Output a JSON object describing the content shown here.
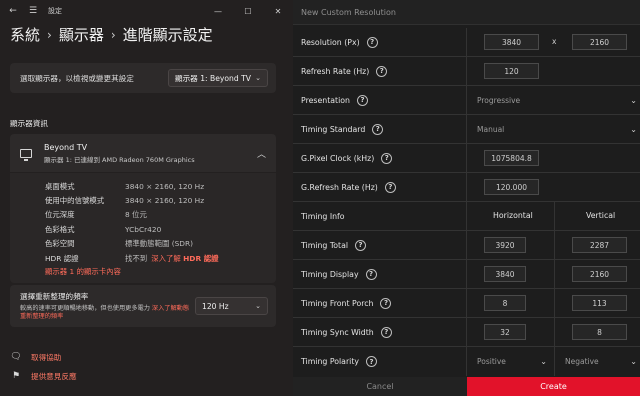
{
  "settings": {
    "window_title": "設定",
    "breadcrumb": [
      "系統",
      "顯示器",
      "進階顯示設定"
    ],
    "select_display": {
      "label": "選取顯示器，以檢視或變更其設定",
      "value": "顯示器 1: Beyond TV"
    },
    "section_title": "顯示器資訊",
    "display_info": {
      "name": "Beyond TV",
      "subtitle": "顯示器 1: 已連線到 AMD Radeon 760M Graphics",
      "rows": [
        {
          "key": "桌面模式",
          "value": "3840 × 2160, 120 Hz"
        },
        {
          "key": "使用中的信號模式",
          "value": "3840 × 2160, 120 Hz"
        },
        {
          "key": "位元深度",
          "value": "8 位元"
        },
        {
          "key": "色彩格式",
          "value": "YCbCr420"
        },
        {
          "key": "色彩空間",
          "value": "標準動態範圍 (SDR)"
        },
        {
          "key": "HDR 認證",
          "value": "找不到",
          "link_prefix": "深入了解",
          "link_bold": "HDR 認證"
        }
      ],
      "adapter_link": "顯示器 1 的顯示卡內容"
    },
    "refresh": {
      "title": "選擇重新整理的頻率",
      "desc": "較高的速率可更順暢地移動，但也使用更多電力",
      "link": "深入了解動態重新整理的頻率",
      "value": "120 Hz"
    },
    "help": [
      {
        "label": "取得協助",
        "icon": "help-chat-icon"
      },
      {
        "label": "提供意見反應",
        "icon": "feedback-icon"
      }
    ],
    "colors": {
      "accent_link": "#ff6b5a",
      "bg": "#232020"
    }
  },
  "panel": {
    "title": "New Custom Resolution",
    "resolution": {
      "label": "Resolution (Px)",
      "width": "3840",
      "sep": "x",
      "height": "2160"
    },
    "refresh_rate": {
      "label": "Refresh Rate (Hz)",
      "value": "120"
    },
    "presentation": {
      "label": "Presentation",
      "value": "Progressive"
    },
    "timing_standard": {
      "label": "Timing Standard",
      "value": "Manual"
    },
    "pixel_clock": {
      "label": "G.Pixel Clock (kHz)",
      "value": "1075804.8"
    },
    "g_refresh": {
      "label": "G.Refresh Rate (Hz)",
      "value": "120.000"
    },
    "timing_info": {
      "label": "Timing Info",
      "col_h": "Horizontal",
      "col_v": "Vertical"
    },
    "timing_rows": [
      {
        "label": "Timing Total",
        "h": "3920",
        "v": "2287"
      },
      {
        "label": "Timing Display",
        "h": "3840",
        "v": "2160"
      },
      {
        "label": "Timing Front Porch",
        "h": "8",
        "v": "113"
      },
      {
        "label": "Timing Sync Width",
        "h": "32",
        "v": "8"
      }
    ],
    "timing_polarity": {
      "label": "Timing Polarity",
      "h": "Positive",
      "v": "Negative"
    },
    "cancel_label": "Cancel",
    "create_label": "Create",
    "colors": {
      "create_bg": "#e2122a",
      "panel_bg": "#1d1d1d"
    }
  }
}
